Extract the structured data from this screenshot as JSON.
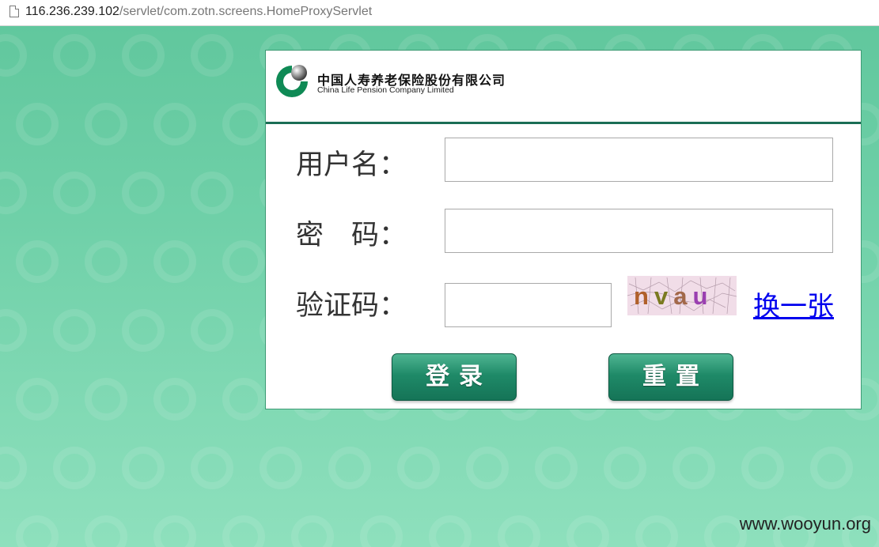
{
  "browser": {
    "url_host": "116.236.239.102",
    "url_path": "/servlet/com.zotn.screens.HomeProxyServlet",
    "page_icon": "page-icon"
  },
  "header": {
    "logo_icon": "china-life-logo-icon",
    "company_cn": "中国人寿养老保险股份有限公司",
    "company_en": "China Life Pension Company Limited",
    "accent": "#1a6e55"
  },
  "form": {
    "username_label": "用户名：",
    "username_value": "",
    "password_label": "密　码：",
    "password_value": "",
    "captcha_label": "验证码：",
    "captcha_value": "",
    "captcha_text": "nvau",
    "refresh_label": "换一张",
    "login_label": "登录",
    "reset_label": "重置"
  },
  "watermark": {
    "site": "www.wooyun.org"
  }
}
